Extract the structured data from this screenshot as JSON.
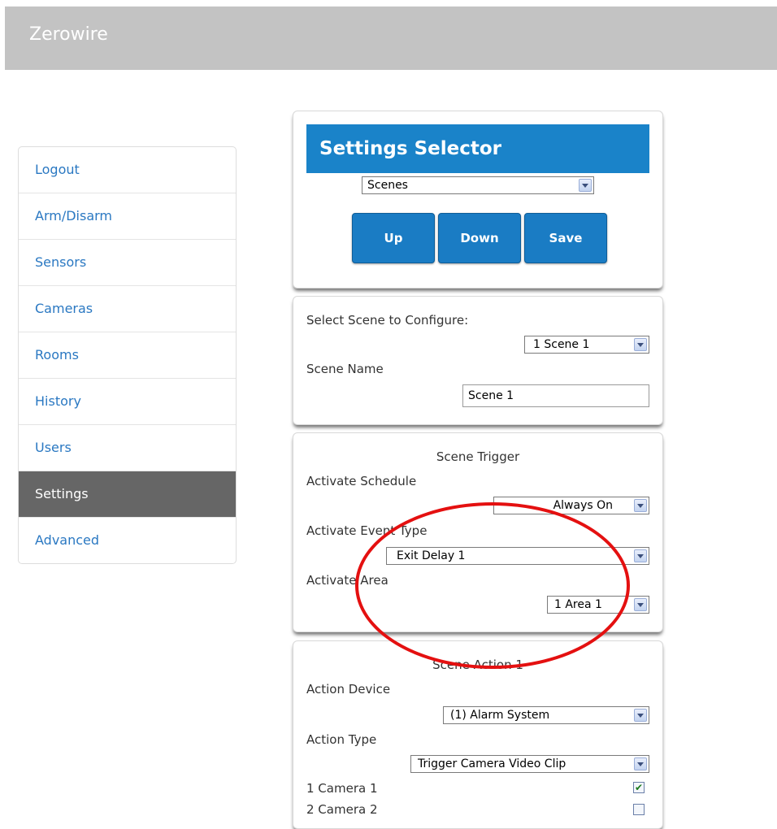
{
  "header": {
    "brand": "Zerowire"
  },
  "sidebar": {
    "items": [
      {
        "label": "Logout"
      },
      {
        "label": "Arm/Disarm"
      },
      {
        "label": "Sensors"
      },
      {
        "label": "Cameras"
      },
      {
        "label": "Rooms"
      },
      {
        "label": "History"
      },
      {
        "label": "Users"
      },
      {
        "label": "Settings",
        "active": true
      },
      {
        "label": "Advanced"
      }
    ]
  },
  "selector": {
    "title": "Settings Selector",
    "selected": "Scenes",
    "buttons": {
      "up": "Up",
      "down": "Down",
      "save": "Save"
    }
  },
  "scene": {
    "select_label": "Select Scene to Configure:",
    "selected_scene": "1 Scene 1",
    "name_label": "Scene Name",
    "name_value": "Scene 1"
  },
  "trigger": {
    "heading": "Scene Trigger",
    "schedule_label": "Activate Schedule",
    "schedule_value": "Always On",
    "event_label": "Activate Event Type",
    "event_value": "Exit Delay 1",
    "area_label": "Activate Area",
    "area_value": "1 Area 1"
  },
  "action": {
    "heading": "Scene Action 1",
    "device_label": "Action Device",
    "device_value": "(1) Alarm System",
    "type_label": "Action Type",
    "type_value": "Trigger Camera Video Clip",
    "cameras": [
      {
        "label": "1 Camera 1",
        "checked": true
      },
      {
        "label": "2 Camera 2",
        "checked": false
      }
    ]
  },
  "colors": {
    "accent": "#1a83c9",
    "sidebar_active": "#666666",
    "topbar": "#c3c3c3",
    "annotation": "#e41010"
  },
  "icons": [
    "dropdown-arrow-icon",
    "checkbox-icon"
  ]
}
